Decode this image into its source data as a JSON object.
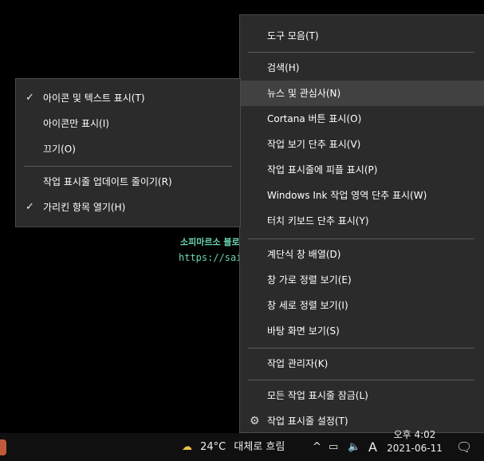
{
  "watermark": {
    "name": "소피마르소 블로그",
    "url": "https://saintone.tistory.com"
  },
  "main_menu": {
    "items": [
      {
        "label": "도구 모음(T)"
      },
      {
        "label": "검색(H)"
      },
      {
        "label": "뉴스 및 관심사(N)"
      },
      {
        "label": "Cortana 버튼 표시(O)"
      },
      {
        "label": "작업 보기 단추 표시(V)"
      },
      {
        "label": "작업 표시줄에 피플 표시(P)"
      },
      {
        "label": "Windows Ink 작업 영역 단추 표시(W)"
      },
      {
        "label": "터치 키보드 단추 표시(Y)"
      },
      {
        "label": "계단식 창 배열(D)"
      },
      {
        "label": "창 가로 정렬 보기(E)"
      },
      {
        "label": "창 세로 정렬 보기(I)"
      },
      {
        "label": "바탕 화면 보기(S)"
      },
      {
        "label": "작업 관리자(K)"
      },
      {
        "label": "모든 작업 표시줄 잠금(L)"
      },
      {
        "label": "작업 표시줄 설정(T)"
      }
    ]
  },
  "submenu": {
    "items": [
      {
        "label": "아이콘 및 텍스트 표시(T)"
      },
      {
        "label": "아이콘만 표시(I)"
      },
      {
        "label": "끄기(O)"
      },
      {
        "label": "작업 표시줄 업데이트 줄이기(R)"
      },
      {
        "label": "가리킨 항목 열기(H)"
      }
    ]
  },
  "taskbar": {
    "temperature": "24°C",
    "weather": "대체로 흐림",
    "ime": "A",
    "time": "오후 4:02",
    "date": "2021-06-11"
  },
  "colors": {
    "menu_bg": "#2b2b2b",
    "highlight": "#414141",
    "annotation_red": "#e00000"
  }
}
